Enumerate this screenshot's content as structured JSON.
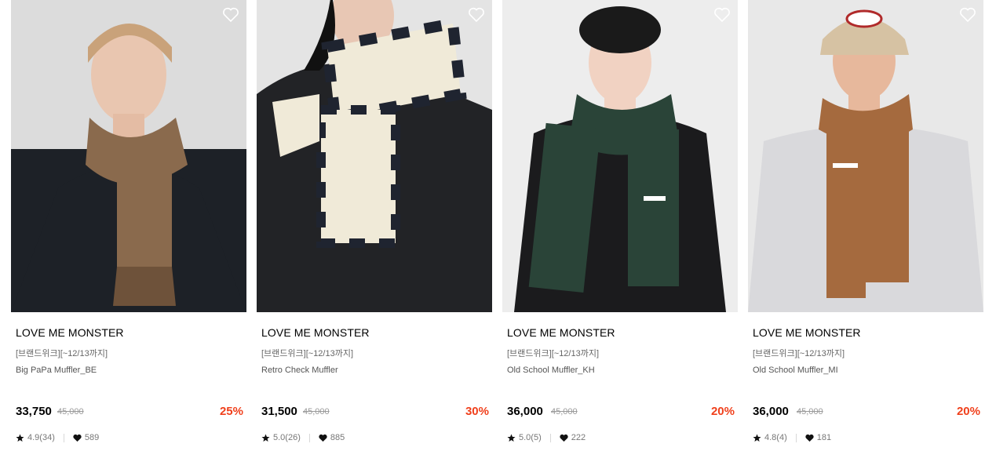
{
  "products": [
    {
      "brand": "LOVE ME MONSTER",
      "event": "[브랜드위크][~12/13까지]",
      "name": "Big PaPa Muffler_BE",
      "price": "33,750",
      "original_price": "45,000",
      "discount": "25%",
      "rating": "4.9(34)",
      "likes": "589",
      "scarf_color": "#8a6a4d",
      "top_color": "#1d2127"
    },
    {
      "brand": "LOVE ME MONSTER",
      "event": "[브랜드위크][~12/13까지]",
      "name": "Retro Check Muffler",
      "price": "31,500",
      "original_price": "45,000",
      "discount": "30%",
      "rating": "5.0(26)",
      "likes": "885",
      "scarf_color": "#f0ead8",
      "top_color": "#222326"
    },
    {
      "brand": "LOVE ME MONSTER",
      "event": "[브랜드위크][~12/13까지]",
      "name": "Old School Muffler_KH",
      "price": "36,000",
      "original_price": "45,000",
      "discount": "20%",
      "rating": "5.0(5)",
      "likes": "222",
      "scarf_color": "#2a4438",
      "top_color": "#1b1b1d"
    },
    {
      "brand": "LOVE ME MONSTER",
      "event": "[브랜드위크][~12/13까지]",
      "name": "Old School Muffler_MI",
      "price": "36,000",
      "original_price": "45,000",
      "discount": "20%",
      "rating": "4.8(4)",
      "likes": "181",
      "scarf_color": "#a56a3e",
      "top_color": "#d9d9dc"
    }
  ],
  "colors": {
    "discount": "#f0401c",
    "price": "#000000",
    "muted": "#9a9a9a"
  },
  "icons": [
    "heart-outline-icon",
    "star-icon",
    "heart-icon"
  ]
}
